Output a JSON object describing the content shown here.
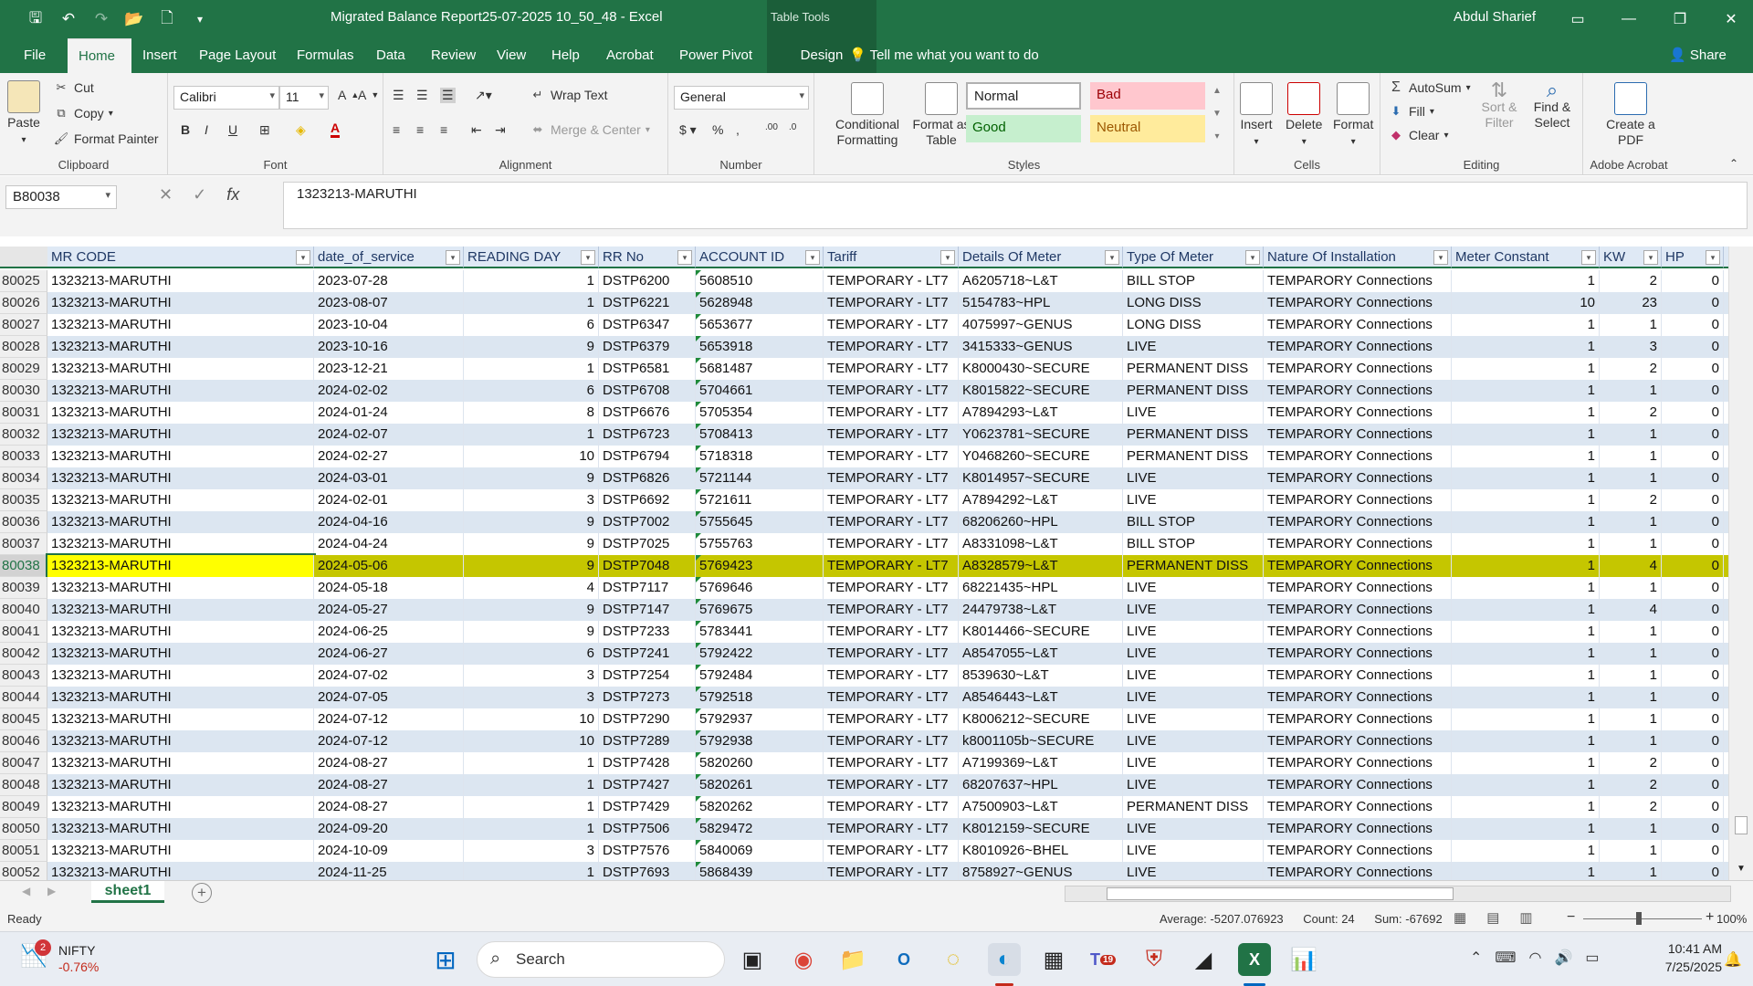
{
  "app": {
    "title": "Migrated Balance Report25-07-2025 10_50_48  -  Excel",
    "table_tools": "Table Tools",
    "user": "Abdul Sharief"
  },
  "tabs": [
    "File",
    "Home",
    "Insert",
    "Page Layout",
    "Formulas",
    "Data",
    "Review",
    "View",
    "Help",
    "Acrobat",
    "Power Pivot",
    "Design"
  ],
  "tell_me": "Tell me what you want to do",
  "share": "Share",
  "ribbon": {
    "clipboard": {
      "label": "Clipboard",
      "paste": "Paste",
      "cut": "Cut",
      "copy": "Copy",
      "format_painter": "Format Painter"
    },
    "font": {
      "label": "Font",
      "name": "Calibri",
      "size": "11"
    },
    "alignment": {
      "label": "Alignment",
      "wrap": "Wrap Text",
      "merge": "Merge & Center"
    },
    "number": {
      "label": "Number",
      "format": "General"
    },
    "styles": {
      "label": "Styles",
      "conditional": "Conditional Formatting",
      "format_as_table": "Format as Table",
      "normal": "Normal",
      "bad": "Bad",
      "good": "Good",
      "neutral": "Neutral"
    },
    "cells": {
      "label": "Cells",
      "insert": "Insert",
      "delete": "Delete",
      "format": "Format"
    },
    "editing": {
      "label": "Editing",
      "autosum": "AutoSum",
      "fill": "Fill",
      "clear": "Clear",
      "sort": "Sort & Filter",
      "find": "Find & Select"
    },
    "acrobat": {
      "label": "Adobe Acrobat",
      "create_pdf": "Create a PDF"
    }
  },
  "formula_bar": {
    "name_box": "B80038",
    "formula": "1323213-MARUTHI"
  },
  "columns": [
    "MR CODE",
    "date_of_service",
    "READING DAY",
    "RR No",
    "ACCOUNT ID",
    "Tariff",
    "Details Of Meter",
    "Type Of Meter",
    "Nature Of Installation",
    "Meter Constant",
    "KW",
    "HP"
  ],
  "col_next": "K",
  "rows": [
    [
      "80025",
      "1323213-MARUTHI",
      "2023-07-28",
      "1",
      "DSTP6200",
      "5608510",
      "TEMPORARY - LT7",
      "A6205718~L&T",
      "BILL STOP",
      "TEMPARORY Connections",
      "1",
      "2",
      "0"
    ],
    [
      "80026",
      "1323213-MARUTHI",
      "2023-08-07",
      "1",
      "DSTP6221",
      "5628948",
      "TEMPORARY - LT7",
      "5154783~HPL",
      "LONG DISS",
      "TEMPARORY Connections",
      "10",
      "23",
      "0"
    ],
    [
      "80027",
      "1323213-MARUTHI",
      "2023-10-04",
      "6",
      "DSTP6347",
      "5653677",
      "TEMPORARY - LT7",
      "4075997~GENUS",
      "LONG DISS",
      "TEMPARORY Connections",
      "1",
      "1",
      "0"
    ],
    [
      "80028",
      "1323213-MARUTHI",
      "2023-10-16",
      "9",
      "DSTP6379",
      "5653918",
      "TEMPORARY - LT7",
      "3415333~GENUS",
      "LIVE",
      "TEMPARORY Connections",
      "1",
      "3",
      "0"
    ],
    [
      "80029",
      "1323213-MARUTHI",
      "2023-12-21",
      "1",
      "DSTP6581",
      "5681487",
      "TEMPORARY - LT7",
      "K8000430~SECURE",
      "PERMANENT DISS",
      "TEMPARORY Connections",
      "1",
      "2",
      "0"
    ],
    [
      "80030",
      "1323213-MARUTHI",
      "2024-02-02",
      "6",
      "DSTP6708",
      "5704661",
      "TEMPORARY - LT7",
      "K8015822~SECURE",
      "PERMANENT DISS",
      "TEMPARORY Connections",
      "1",
      "1",
      "0"
    ],
    [
      "80031",
      "1323213-MARUTHI",
      "2024-01-24",
      "8",
      "DSTP6676",
      "5705354",
      "TEMPORARY - LT7",
      "A7894293~L&T",
      "LIVE",
      "TEMPARORY Connections",
      "1",
      "2",
      "0"
    ],
    [
      "80032",
      "1323213-MARUTHI",
      "2024-02-07",
      "1",
      "DSTP6723",
      "5708413",
      "TEMPORARY - LT7",
      "Y0623781~SECURE",
      "PERMANENT DISS",
      "TEMPARORY Connections",
      "1",
      "1",
      "0"
    ],
    [
      "80033",
      "1323213-MARUTHI",
      "2024-02-27",
      "10",
      "DSTP6794",
      "5718318",
      "TEMPORARY - LT7",
      "Y0468260~SECURE",
      "PERMANENT DISS",
      "TEMPARORY Connections",
      "1",
      "1",
      "0"
    ],
    [
      "80034",
      "1323213-MARUTHI",
      "2024-03-01",
      "9",
      "DSTP6826",
      "5721144",
      "TEMPORARY - LT7",
      "K8014957~SECURE",
      "LIVE",
      "TEMPARORY Connections",
      "1",
      "1",
      "0"
    ],
    [
      "80035",
      "1323213-MARUTHI",
      "2024-02-01",
      "3",
      "DSTP6692",
      "5721611",
      "TEMPORARY - LT7",
      "A7894292~L&T",
      "LIVE",
      "TEMPARORY Connections",
      "1",
      "2",
      "0"
    ],
    [
      "80036",
      "1323213-MARUTHI",
      "2024-04-16",
      "9",
      "DSTP7002",
      "5755645",
      "TEMPORARY - LT7",
      "68206260~HPL",
      "BILL STOP",
      "TEMPARORY Connections",
      "1",
      "1",
      "0"
    ],
    [
      "80037",
      "1323213-MARUTHI",
      "2024-04-24",
      "9",
      "DSTP7025",
      "5755763",
      "TEMPORARY - LT7",
      "A8331098~L&T",
      "BILL STOP",
      "TEMPARORY Connections",
      "1",
      "1",
      "0"
    ],
    [
      "80038",
      "1323213-MARUTHI",
      "2024-05-06",
      "9",
      "DSTP7048",
      "5769423",
      "TEMPORARY - LT7",
      "A8328579~L&T",
      "PERMANENT DISS",
      "TEMPARORY Connections",
      "1",
      "4",
      "0"
    ],
    [
      "80039",
      "1323213-MARUTHI",
      "2024-05-18",
      "4",
      "DSTP7117",
      "5769646",
      "TEMPORARY - LT7",
      "68221435~HPL",
      "LIVE",
      "TEMPARORY Connections",
      "1",
      "1",
      "0"
    ],
    [
      "80040",
      "1323213-MARUTHI",
      "2024-05-27",
      "9",
      "DSTP7147",
      "5769675",
      "TEMPORARY - LT7",
      "24479738~L&T",
      "LIVE",
      "TEMPARORY Connections",
      "1",
      "4",
      "0"
    ],
    [
      "80041",
      "1323213-MARUTHI",
      "2024-06-25",
      "9",
      "DSTP7233",
      "5783441",
      "TEMPORARY - LT7",
      "K8014466~SECURE",
      "LIVE",
      "TEMPARORY Connections",
      "1",
      "1",
      "0"
    ],
    [
      "80042",
      "1323213-MARUTHI",
      "2024-06-27",
      "6",
      "DSTP7241",
      "5792422",
      "TEMPORARY - LT7",
      "A8547055~L&T",
      "LIVE",
      "TEMPARORY Connections",
      "1",
      "1",
      "0"
    ],
    [
      "80043",
      "1323213-MARUTHI",
      "2024-07-02",
      "3",
      "DSTP7254",
      "5792484",
      "TEMPORARY - LT7",
      "8539630~L&T",
      "LIVE",
      "TEMPARORY Connections",
      "1",
      "1",
      "0"
    ],
    [
      "80044",
      "1323213-MARUTHI",
      "2024-07-05",
      "3",
      "DSTP7273",
      "5792518",
      "TEMPORARY - LT7",
      "A8546443~L&T",
      "LIVE",
      "TEMPARORY Connections",
      "1",
      "1",
      "0"
    ],
    [
      "80045",
      "1323213-MARUTHI",
      "2024-07-12",
      "10",
      "DSTP7290",
      "5792937",
      "TEMPORARY - LT7",
      "K8006212~SECURE",
      "LIVE",
      "TEMPARORY Connections",
      "1",
      "1",
      "0"
    ],
    [
      "80046",
      "1323213-MARUTHI",
      "2024-07-12",
      "10",
      "DSTP7289",
      "5792938",
      "TEMPORARY - LT7",
      "k8001105b~SECURE",
      "LIVE",
      "TEMPARORY Connections",
      "1",
      "1",
      "0"
    ],
    [
      "80047",
      "1323213-MARUTHI",
      "2024-08-27",
      "1",
      "DSTP7428",
      "5820260",
      "TEMPORARY - LT7",
      "A7199369~L&T",
      "LIVE",
      "TEMPARORY Connections",
      "1",
      "2",
      "0"
    ],
    [
      "80048",
      "1323213-MARUTHI",
      "2024-08-27",
      "1",
      "DSTP7427",
      "5820261",
      "TEMPORARY - LT7",
      "68207637~HPL",
      "LIVE",
      "TEMPARORY Connections",
      "1",
      "2",
      "0"
    ],
    [
      "80049",
      "1323213-MARUTHI",
      "2024-08-27",
      "1",
      "DSTP7429",
      "5820262",
      "TEMPORARY - LT7",
      "A7500903~L&T",
      "PERMANENT DISS",
      "TEMPARORY Connections",
      "1",
      "2",
      "0"
    ],
    [
      "80050",
      "1323213-MARUTHI",
      "2024-09-20",
      "1",
      "DSTP7506",
      "5829472",
      "TEMPORARY - LT7",
      "K8012159~SECURE",
      "LIVE",
      "TEMPARORY Connections",
      "1",
      "1",
      "0"
    ],
    [
      "80051",
      "1323213-MARUTHI",
      "2024-10-09",
      "3",
      "DSTP7576",
      "5840069",
      "TEMPORARY - LT7",
      "K8010926~BHEL",
      "LIVE",
      "TEMPARORY Connections",
      "1",
      "1",
      "0"
    ],
    [
      "80052",
      "1323213-MARUTHI",
      "2024-11-25",
      "1",
      "DSTP7693",
      "5868439",
      "TEMPORARY - LT7",
      "8758927~GENUS",
      "LIVE",
      "TEMPARORY Connections",
      "1",
      "1",
      "0"
    ]
  ],
  "selected_row": "80038",
  "sheet_tab": "sheet1",
  "status": {
    "ready": "Ready",
    "average": "Average: -5207.076923",
    "count": "Count: 24",
    "sum": "Sum: -67692",
    "zoom": "100%"
  },
  "taskbar": {
    "widget_name": "NIFTY",
    "widget_change": "-0.76%",
    "widget_badge": "2",
    "search": "Search",
    "teams_badge": "19",
    "time": "10:41 AM",
    "date": "7/25/2025"
  },
  "colors": {
    "excel_green": "#217346",
    "selected_row": "#c5c600",
    "selected_cell": "#ffff00",
    "band": "#dce6f1"
  }
}
